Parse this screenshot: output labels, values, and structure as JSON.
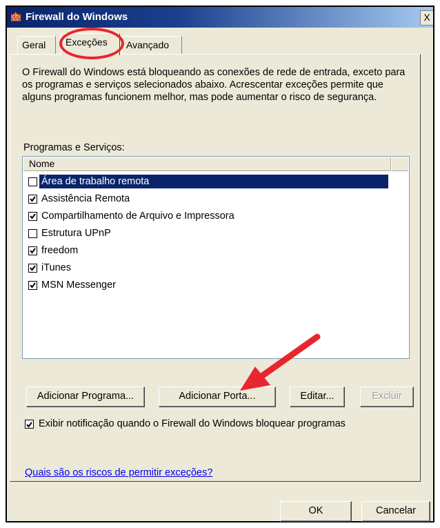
{
  "window": {
    "title": "Firewall do Windows",
    "close_glyph": "X"
  },
  "tabs": [
    {
      "label": "Geral",
      "active": false
    },
    {
      "label": "Exceções",
      "active": true
    },
    {
      "label": "Avançado",
      "active": false
    }
  ],
  "exceptions": {
    "description": "O Firewall do Windows está bloqueando as conexões de rede de entrada, exceto para os programas e serviços selecionados abaixo. Acrescentar exceções permite que alguns programas funcionem melhor, mas pode aumentar o risco de segurança.",
    "list_label": "Programas e Serviços:",
    "column_header": "Nome",
    "items": [
      {
        "label": "Área de trabalho remota",
        "checked": false,
        "selected": true
      },
      {
        "label": "Assistência Remota",
        "checked": true,
        "selected": false
      },
      {
        "label": "Compartilhamento de Arquivo e Impressora",
        "checked": true,
        "selected": false
      },
      {
        "label": "Estrutura UPnP",
        "checked": false,
        "selected": false
      },
      {
        "label": "freedom",
        "checked": true,
        "selected": false
      },
      {
        "label": "iTunes",
        "checked": true,
        "selected": false
      },
      {
        "label": "MSN Messenger",
        "checked": true,
        "selected": false
      }
    ],
    "buttons": {
      "add_program": "Adicionar Programa...",
      "add_port": "Adicionar Porta...",
      "edit": "Editar...",
      "delete": "Excluir"
    },
    "notify_checkbox": {
      "label": "Exibir notificação quando o Firewall do Windows bloquear programas",
      "checked": true
    },
    "help_link": "Quais são os riscos de permitir exceções?"
  },
  "footer": {
    "ok": "OK",
    "cancel": "Cancelar"
  },
  "annotation_color": "#e8262d"
}
